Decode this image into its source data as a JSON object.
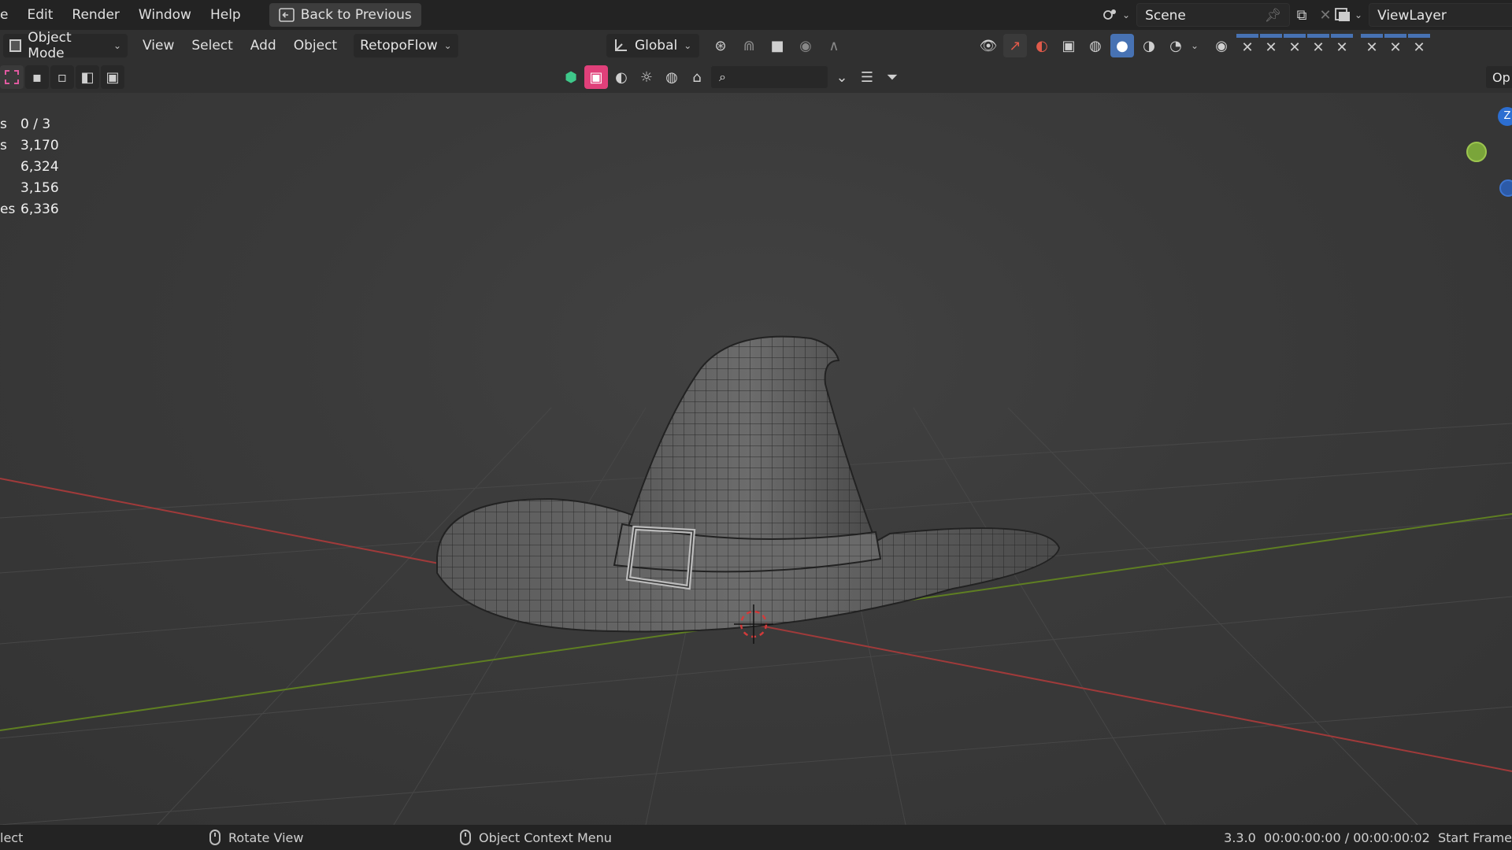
{
  "topbar": {
    "menus": [
      "e",
      "Edit",
      "Render",
      "Window",
      "Help"
    ],
    "back_button": "Back to Previous",
    "scene_field": "Scene",
    "viewlayer_field": "ViewLayer"
  },
  "header": {
    "mode": "Object Mode",
    "menus": [
      "View",
      "Select",
      "Add",
      "Object"
    ],
    "addon_menu": "RetopoFlow",
    "transform_orientation": "Global"
  },
  "header3": {
    "search_placeholder": "",
    "options_label": "Op"
  },
  "stats": [
    {
      "key": "s",
      "value": "0 / 3"
    },
    {
      "key": "s",
      "value": "3,170"
    },
    {
      "key": "",
      "value": "6,324"
    },
    {
      "key": "",
      "value": "3,156"
    },
    {
      "key": "es",
      "value": "6,336"
    }
  ],
  "gizmo": {
    "z_label": "Z"
  },
  "statusbar": {
    "left": "lect",
    "rotate": "Rotate View",
    "context": "Object Context Menu",
    "right": "3.3.0  00:00:00:00 / 00:00:00:02  Start Frame"
  },
  "colors": {
    "accent": "#4772b3",
    "x_axis": "#b23a3a",
    "y_axis": "#6b8e23"
  }
}
